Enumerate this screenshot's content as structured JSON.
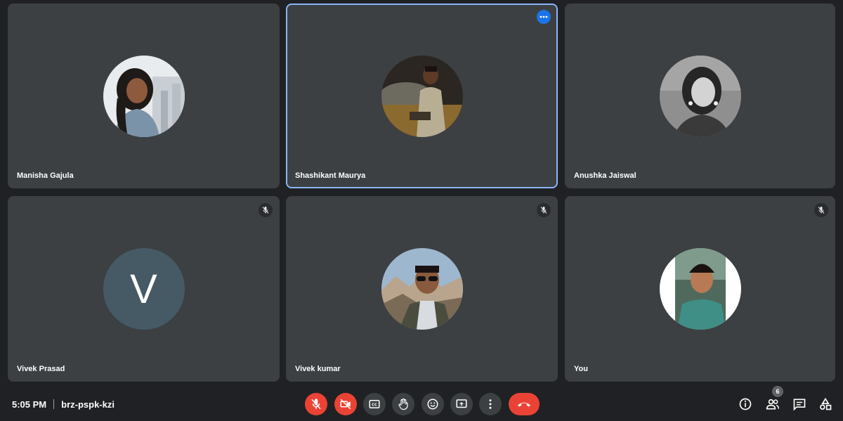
{
  "participants": [
    {
      "name": "Manisha Gajula",
      "avatar": "photo-woman-icon",
      "muted": false,
      "active": false
    },
    {
      "name": "Shashikant Maurya",
      "avatar": "photo-man-car-icon",
      "muted": false,
      "active": true
    },
    {
      "name": "Anushka Jaiswal",
      "avatar": "photo-woman-grayscale-icon",
      "muted": false,
      "active": false
    },
    {
      "name": "Vivek Prasad",
      "initial": "V",
      "avatar_color": "#455a64",
      "muted": true,
      "active": false
    },
    {
      "name": "Vivek kumar",
      "avatar": "photo-man-sunglasses-icon",
      "muted": true,
      "active": false
    },
    {
      "name": "You",
      "avatar": "photo-man-selfie-icon",
      "muted": true,
      "active": false
    }
  ],
  "meeting": {
    "time": "5:05 PM",
    "code": "brz-pspk-kzi"
  },
  "controls": [
    "mic-off-icon",
    "camera-off-icon",
    "captions-icon",
    "raise-hand-icon",
    "emoji-icon",
    "present-screen-icon",
    "more-options-icon",
    "end-call-icon"
  ],
  "right_controls": [
    "info-icon",
    "people-icon",
    "chat-icon",
    "activities-icon"
  ],
  "people_count": "6",
  "colors": {
    "tile": "#3c4043",
    "background": "#202124",
    "accent": "#8ab4f8",
    "danger": "#ea4335"
  }
}
